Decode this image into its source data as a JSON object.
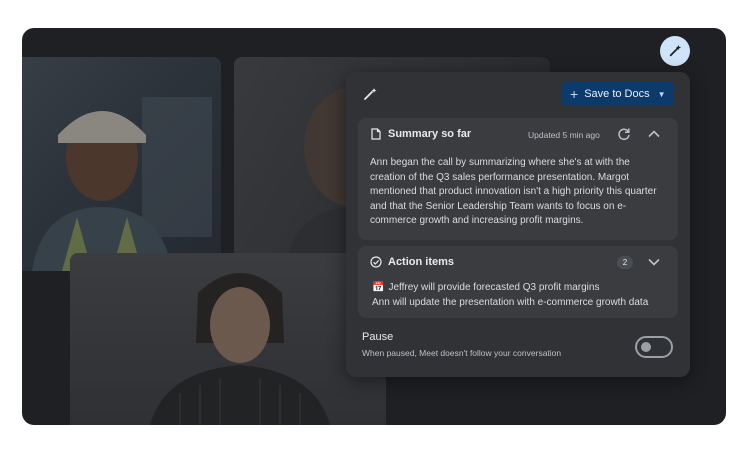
{
  "header": {
    "save_label": "Save to Docs"
  },
  "summary": {
    "title": "Summary so far",
    "updated": "Updated 5 min ago",
    "text": "Ann began the call by summarizing where she's at with the creation of the Q3 sales performance presentation. Margot mentioned that product innovation isn't a high priority this quarter and that the Senior Leadership Team wants to focus on e-commerce growth and increasing profit margins."
  },
  "actions": {
    "title": "Action items",
    "count": "2",
    "items": [
      "Jeffrey will provide forecasted Q3 profit margins",
      "Ann will update the presentation with e-commerce growth data"
    ]
  },
  "pause": {
    "label": "Pause",
    "description": "When paused, Meet doesn't follow your conversation",
    "enabled": false
  },
  "colors": {
    "panel": "#303236",
    "card": "#3a3c40",
    "save_button": "#0b3a6b",
    "fab": "#cfe4fb"
  },
  "icons": {
    "wand": "magic-wand-icon",
    "document": "document-icon",
    "refresh": "refresh-icon",
    "collapse": "chevron-up-icon",
    "expand": "chevron-down-icon",
    "check": "check-circle-icon",
    "calendar": "calendar-icon",
    "add": "plus-icon",
    "dropdown": "caret-down-icon"
  }
}
